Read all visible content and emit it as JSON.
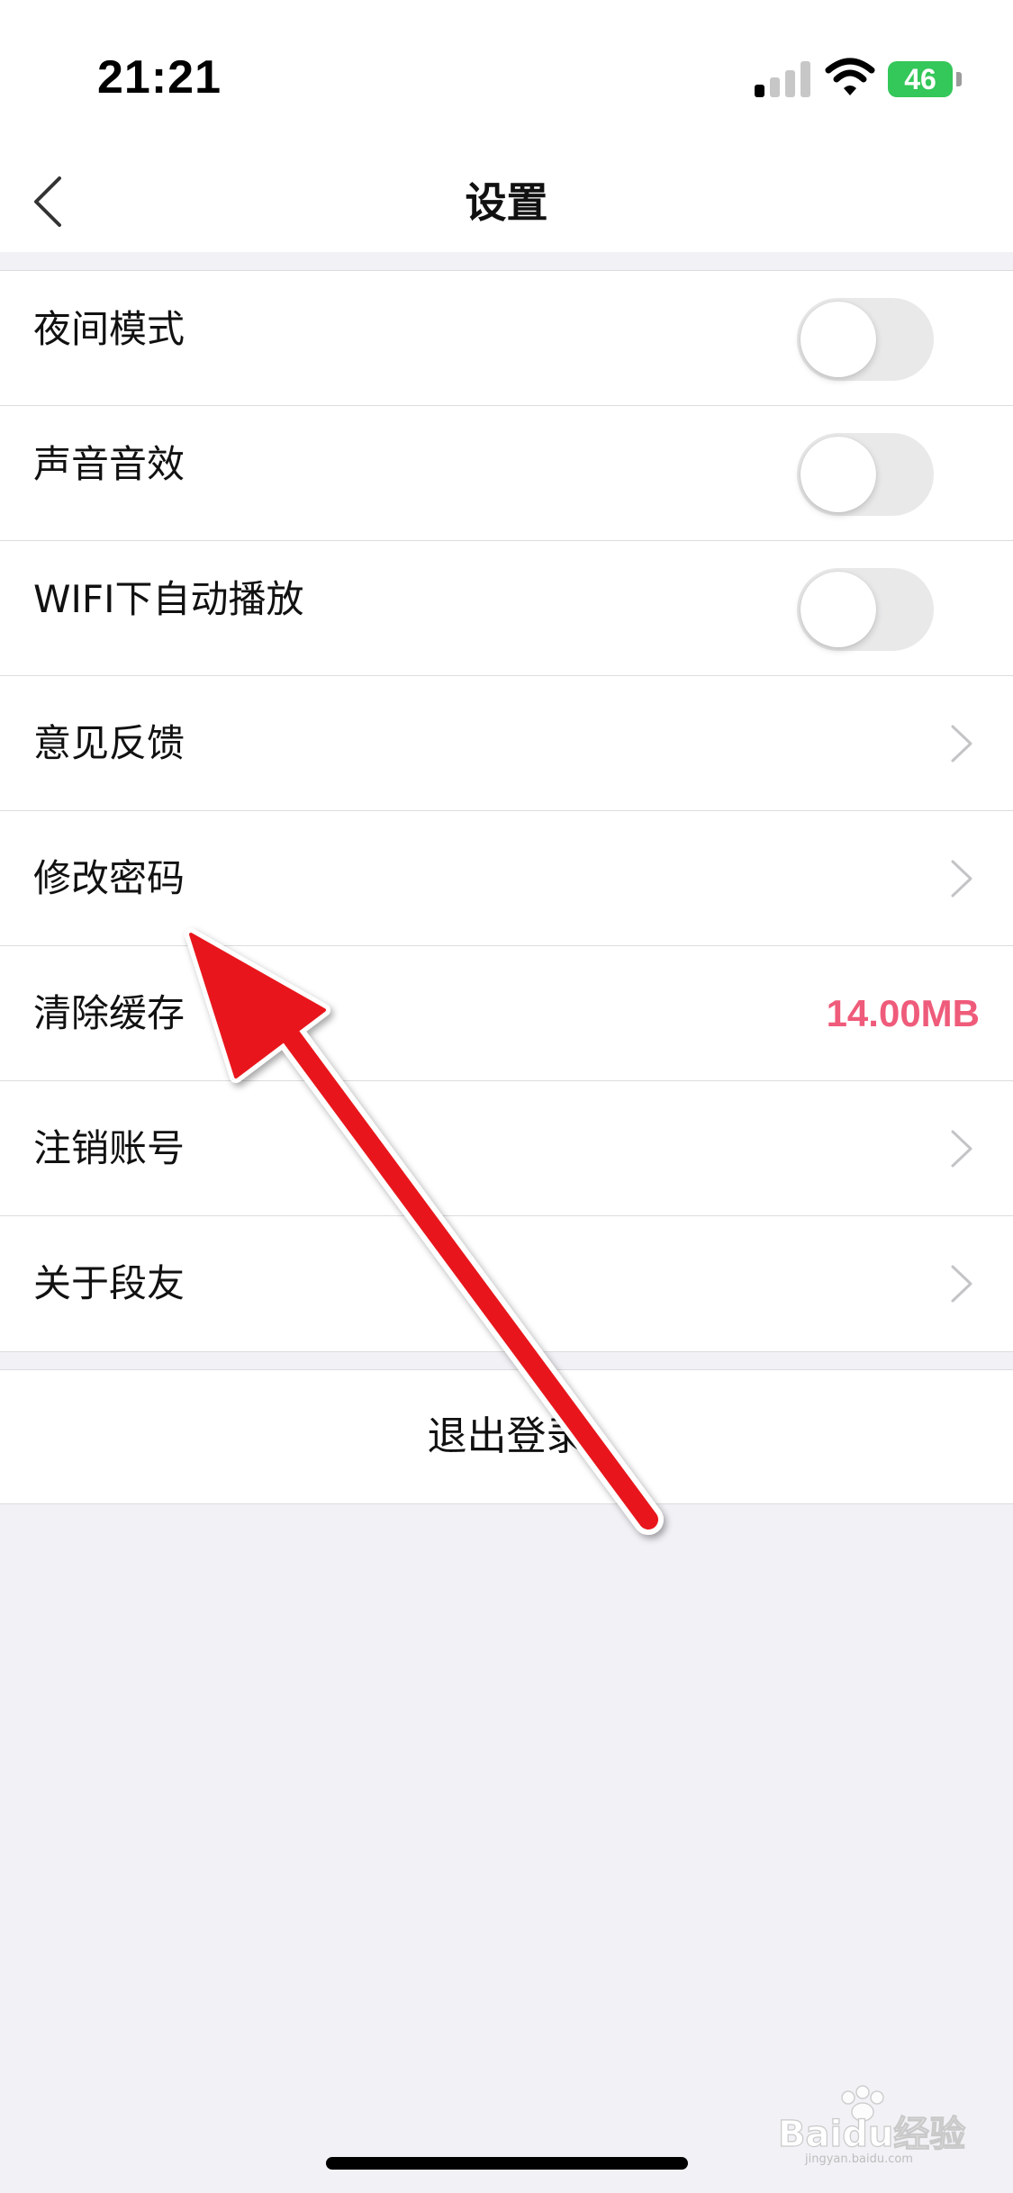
{
  "status_bar": {
    "time": "21:21",
    "battery_level": "46",
    "battery_color": "#34c759",
    "signal_bars_active": 1,
    "signal_bars_total": 4,
    "icons": [
      "cellular-signal-icon",
      "wifi-icon",
      "charging-battery-icon"
    ]
  },
  "nav": {
    "title": "设置",
    "back_icon": "chevron-left-icon"
  },
  "settings": {
    "night_mode": {
      "label": "夜间模式",
      "enabled": false
    },
    "sound_effects": {
      "label": "声音音效",
      "enabled": false
    },
    "wifi_autoplay": {
      "label": "WIFI下自动播放",
      "enabled": false
    },
    "feedback": {
      "label": "意见反馈"
    },
    "change_password": {
      "label": "修改密码"
    },
    "clear_cache": {
      "label": "清除缓存",
      "value": "14.00MB"
    },
    "deactivate_account": {
      "label": "注销账号"
    },
    "about": {
      "label": "关于段友"
    }
  },
  "logout": {
    "label": "退出登录"
  },
  "watermark": {
    "text": "Baidu经验",
    "subtext": "jingyan.baidu.com"
  },
  "colors": {
    "accent": "#ef5b7a",
    "background": "#f2f1f6",
    "arrow": "#e8151b"
  }
}
